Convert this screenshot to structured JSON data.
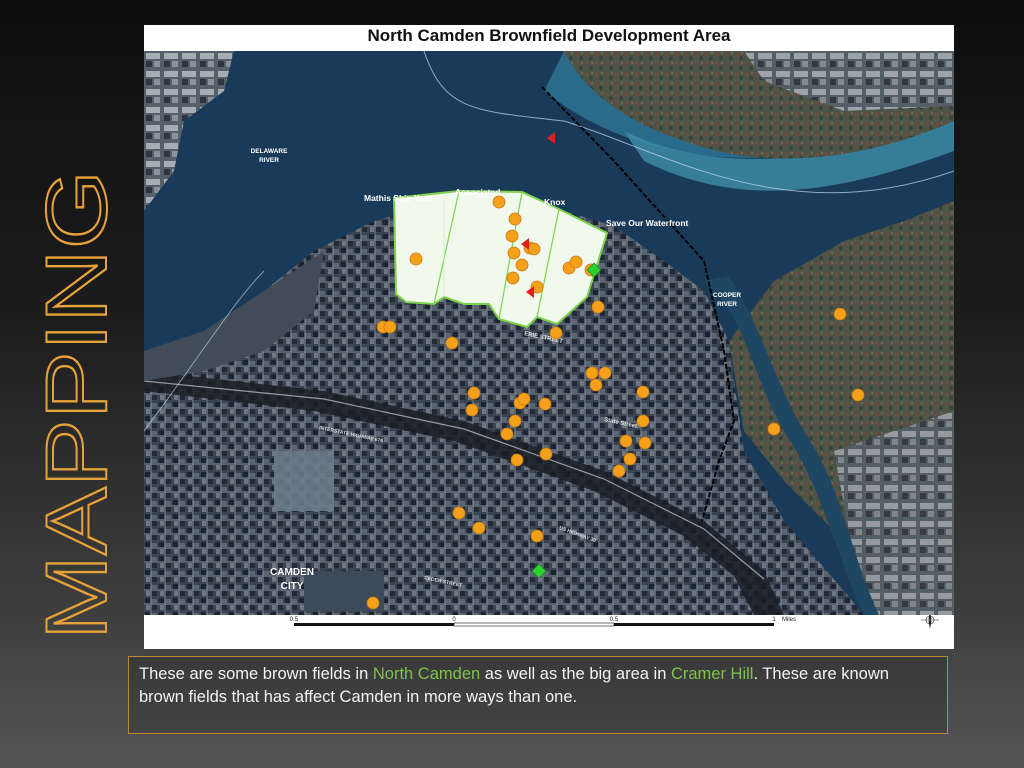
{
  "slide": {
    "side_title": "MAPPING",
    "accent_color": "#e8a23a"
  },
  "map": {
    "title": "North Camden Brownfield Development Area",
    "labels": {
      "delaware_river_1": "DELAWARE",
      "delaware_river_2": "RIVER",
      "cooper_river_1": "COOPER",
      "cooper_river_2": "RIVER",
      "mathis": "Mathis Ship Yard",
      "associated": "Associated",
      "knox": "Knox",
      "save_waterfront": "Save Our Waterfront",
      "erie_street": "ERIE STREET",
      "state_street": "State Street",
      "interstate": "INTERSTATE HIGHWAY 676",
      "highway": "US HIGHWAY 30",
      "camden_1": "CAMDEN",
      "camden_2": "CITY",
      "street_bottom": "CEDER STREET"
    },
    "scale": {
      "t0": "0.5",
      "t1": "0",
      "t2": "0.5",
      "t3": "1",
      "unit": "Miles"
    },
    "marker_colors": {
      "site": "#f5a01a",
      "triangle": "#d8231b",
      "diamond": "#2bd12e",
      "zone": "#f1f8ec"
    }
  },
  "caption": {
    "part1": "These are some brown fields in ",
    "hl1": "North Camden",
    "part2": " as well as the big area in ",
    "hl2": "Cramer Hill",
    "part3": ".  These are known brown fields that has affect Camden in more ways than one."
  }
}
